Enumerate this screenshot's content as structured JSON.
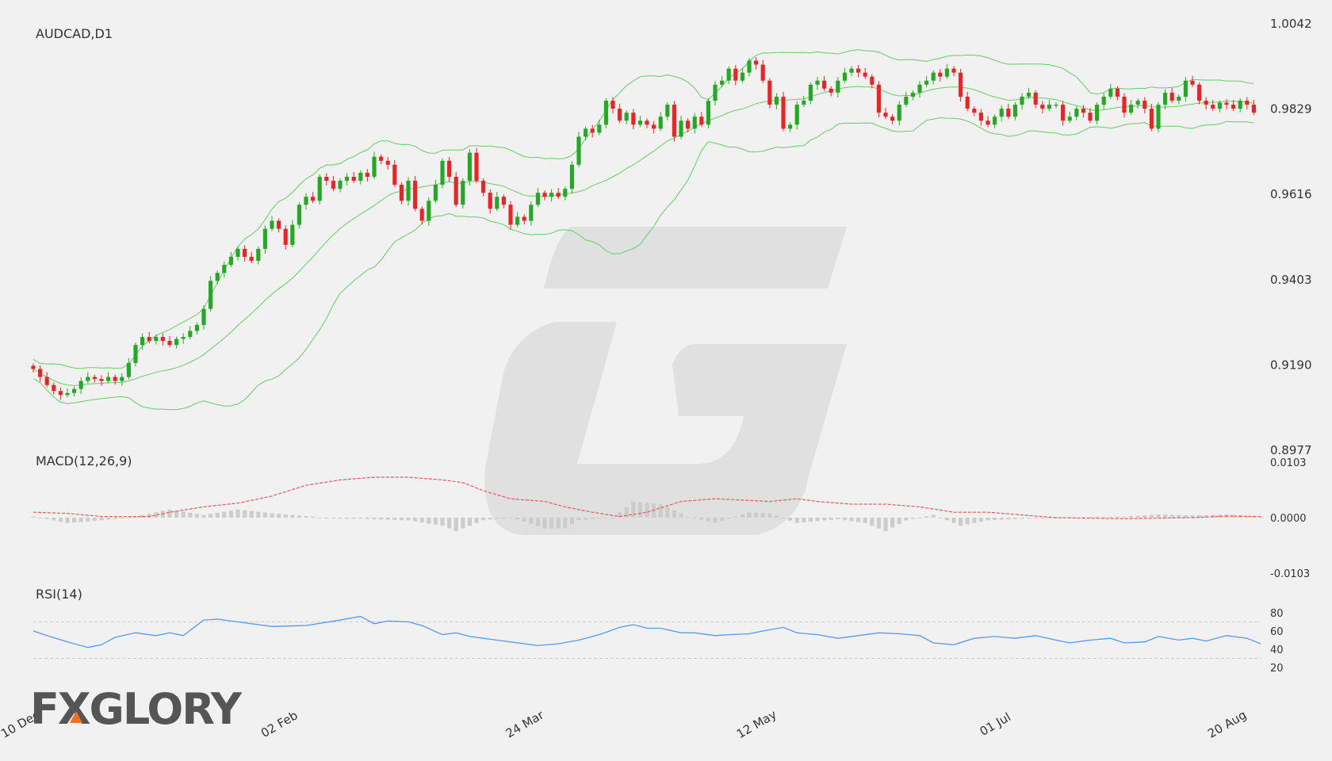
{
  "chart_data": [
    {
      "type": "candlestick",
      "title": "AUDCAD,D1",
      "y_ticks": [
        "1.0042",
        "0.9829",
        "0.9616",
        "0.9403",
        "0.9190",
        "0.8977"
      ],
      "ylim": [
        0.8977,
        1.0042
      ],
      "x_ticks": [
        "10 Dec",
        "02 Feb",
        "24 Mar",
        "12 May",
        "01 Jul",
        "20 Aug"
      ],
      "x_tick_index": [
        0,
        38,
        74,
        108,
        143,
        177
      ],
      "colors": {
        "up": "#22aa22",
        "down": "#ee2222",
        "bands": "#66cc66"
      },
      "close": [
        0.918,
        0.916,
        0.914,
        0.9125,
        0.9115,
        0.912,
        0.913,
        0.915,
        0.916,
        0.9155,
        0.915,
        0.916,
        0.915,
        0.916,
        0.9195,
        0.924,
        0.926,
        0.925,
        0.926,
        0.925,
        0.924,
        0.9255,
        0.926,
        0.9275,
        0.929,
        0.933,
        0.94,
        0.942,
        0.944,
        0.946,
        0.948,
        0.946,
        0.945,
        0.948,
        0.953,
        0.955,
        0.953,
        0.949,
        0.954,
        0.959,
        0.961,
        0.96,
        0.966,
        0.965,
        0.963,
        0.965,
        0.966,
        0.965,
        0.967,
        0.966,
        0.971,
        0.97,
        0.969,
        0.964,
        0.96,
        0.965,
        0.958,
        0.955,
        0.96,
        0.964,
        0.97,
        0.966,
        0.959,
        0.965,
        0.972,
        0.965,
        0.962,
        0.958,
        0.961,
        0.959,
        0.954,
        0.956,
        0.955,
        0.959,
        0.962,
        0.961,
        0.962,
        0.961,
        0.963,
        0.969,
        0.976,
        0.978,
        0.977,
        0.979,
        0.985,
        0.983,
        0.98,
        0.982,
        0.979,
        0.98,
        0.979,
        0.978,
        0.981,
        0.984,
        0.976,
        0.98,
        0.978,
        0.981,
        0.979,
        0.985,
        0.989,
        0.99,
        0.993,
        0.99,
        0.992,
        0.995,
        0.994,
        0.99,
        0.984,
        0.986,
        0.978,
        0.979,
        0.984,
        0.985,
        0.989,
        0.99,
        0.988,
        0.987,
        0.99,
        0.992,
        0.993,
        0.992,
        0.991,
        0.989,
        0.982,
        0.981,
        0.98,
        0.984,
        0.986,
        0.987,
        0.989,
        0.99,
        0.992,
        0.991,
        0.993,
        0.992,
        0.986,
        0.983,
        0.982,
        0.98,
        0.979,
        0.981,
        0.983,
        0.981,
        0.984,
        0.986,
        0.987,
        0.984,
        0.983,
        0.984,
        0.984,
        0.98,
        0.981,
        0.983,
        0.982,
        0.98,
        0.984,
        0.986,
        0.988,
        0.986,
        0.982,
        0.984,
        0.985,
        0.983,
        0.978,
        0.984,
        0.987,
        0.985,
        0.986,
        0.99,
        0.989,
        0.985,
        0.984,
        0.983,
        0.9845,
        0.984,
        0.983,
        0.985,
        0.984,
        0.982
      ],
      "indicators": [
        "Bollinger Bands"
      ]
    },
    {
      "type": "macd",
      "title": "MACD(12,26,9)",
      "y_ticks": [
        "0.0103",
        "0.0000",
        "-0.0103"
      ],
      "ylim": [
        -0.0103,
        0.0103
      ],
      "signal_points": [
        [
          0,
          0.001
        ],
        [
          5,
          0.0008
        ],
        [
          10,
          0.0002
        ],
        [
          17,
          0.0002
        ],
        [
          20,
          0.001
        ],
        [
          25,
          0.002
        ],
        [
          30,
          0.0027
        ],
        [
          35,
          0.004
        ],
        [
          40,
          0.006
        ],
        [
          45,
          0.007
        ],
        [
          50,
          0.0075
        ],
        [
          55,
          0.0075
        ],
        [
          60,
          0.007
        ],
        [
          63,
          0.0065
        ],
        [
          66,
          0.005
        ],
        [
          70,
          0.0035
        ],
        [
          75,
          0.003
        ],
        [
          78,
          0.002
        ],
        [
          82,
          0.001
        ],
        [
          86,
          0.0002
        ],
        [
          90,
          0.001
        ],
        [
          95,
          0.003
        ],
        [
          100,
          0.0035
        ],
        [
          105,
          0.0032
        ],
        [
          108,
          0.003
        ],
        [
          112,
          0.0035
        ],
        [
          115,
          0.003
        ],
        [
          120,
          0.0025
        ],
        [
          125,
          0.0025
        ],
        [
          130,
          0.002
        ],
        [
          135,
          0.001
        ],
        [
          140,
          0.001
        ],
        [
          145,
          0.0005
        ],
        [
          150,
          0.0
        ],
        [
          160,
          -0.0002
        ],
        [
          170,
          0.0
        ],
        [
          175,
          0.0003
        ],
        [
          180,
          0.0002
        ]
      ],
      "histogram_points": [
        [
          0,
          0.0002
        ],
        [
          5,
          -0.001
        ],
        [
          10,
          -0.0005
        ],
        [
          15,
          0.0002
        ],
        [
          20,
          0.0015
        ],
        [
          25,
          0.0005
        ],
        [
          30,
          0.0015
        ],
        [
          35,
          0.0008
        ],
        [
          40,
          0.0003
        ],
        [
          45,
          -0.0002
        ],
        [
          48,
          -0.0002
        ],
        [
          55,
          -0.0005
        ],
        [
          60,
          -0.0015
        ],
        [
          62,
          -0.0025
        ],
        [
          66,
          -0.0005
        ],
        [
          70,
          0.0001
        ],
        [
          75,
          -0.002
        ],
        [
          78,
          -0.002
        ],
        [
          80,
          -0.0005
        ],
        [
          85,
          0.0
        ],
        [
          88,
          0.003
        ],
        [
          92,
          0.0025
        ],
        [
          96,
          0.0002
        ],
        [
          100,
          -0.001
        ],
        [
          105,
          0.001
        ],
        [
          108,
          0.0008
        ],
        [
          112,
          -0.001
        ],
        [
          118,
          -0.0003
        ],
        [
          122,
          -0.001
        ],
        [
          125,
          -0.0025
        ],
        [
          128,
          -0.0005
        ],
        [
          132,
          0.0005
        ],
        [
          136,
          -0.0015
        ],
        [
          140,
          -0.0005
        ],
        [
          145,
          -0.0002
        ],
        [
          150,
          0.0
        ],
        [
          160,
          0.0002
        ],
        [
          165,
          0.0006
        ],
        [
          170,
          0.0004
        ],
        [
          175,
          0.0006
        ],
        [
          180,
          0.0002
        ]
      ],
      "colors": {
        "signal": "#ee5555",
        "histogram": "#cccccc"
      }
    },
    {
      "type": "line",
      "title": "RSI(14)",
      "y_ticks": [
        "80",
        "60",
        "40",
        "20"
      ],
      "ylim": [
        20,
        80
      ],
      "levels": [
        70,
        30
      ],
      "points": [
        [
          0,
          60
        ],
        [
          2,
          55
        ],
        [
          5,
          48
        ],
        [
          8,
          42
        ],
        [
          10,
          45
        ],
        [
          12,
          53
        ],
        [
          15,
          58
        ],
        [
          18,
          55
        ],
        [
          20,
          58
        ],
        [
          22,
          55
        ],
        [
          25,
          72
        ],
        [
          27,
          73
        ],
        [
          30,
          70
        ],
        [
          35,
          65
        ],
        [
          40,
          66
        ],
        [
          45,
          72
        ],
        [
          48,
          76
        ],
        [
          50,
          68
        ],
        [
          52,
          71
        ],
        [
          55,
          70
        ],
        [
          57,
          66
        ],
        [
          60,
          56
        ],
        [
          62,
          58
        ],
        [
          64,
          54
        ],
        [
          66,
          52
        ],
        [
          68,
          50
        ],
        [
          70,
          48
        ],
        [
          74,
          44
        ],
        [
          77,
          46
        ],
        [
          80,
          50
        ],
        [
          83,
          56
        ],
        [
          86,
          64
        ],
        [
          88,
          67
        ],
        [
          90,
          63
        ],
        [
          92,
          63
        ],
        [
          95,
          58
        ],
        [
          97,
          58
        ],
        [
          100,
          55
        ],
        [
          102,
          56
        ],
        [
          105,
          57
        ],
        [
          107,
          60
        ],
        [
          110,
          64
        ],
        [
          112,
          58
        ],
        [
          115,
          56
        ],
        [
          118,
          52
        ],
        [
          121,
          55
        ],
        [
          124,
          58
        ],
        [
          127,
          57
        ],
        [
          130,
          55
        ],
        [
          132,
          47
        ],
        [
          135,
          45
        ],
        [
          138,
          52
        ],
        [
          141,
          54
        ],
        [
          144,
          52
        ],
        [
          147,
          55
        ],
        [
          150,
          50
        ],
        [
          152,
          47
        ],
        [
          155,
          50
        ],
        [
          158,
          52
        ],
        [
          160,
          47
        ],
        [
          163,
          48
        ],
        [
          165,
          54
        ],
        [
          168,
          50
        ],
        [
          170,
          52
        ],
        [
          172,
          49
        ],
        [
          175,
          55
        ],
        [
          178,
          52
        ],
        [
          180,
          46
        ]
      ],
      "colors": {
        "line": "#5599ee",
        "levels": "#cccccc"
      }
    }
  ],
  "axis_label_color": "#333333",
  "watermark": {
    "brand": "FXGLORY"
  }
}
